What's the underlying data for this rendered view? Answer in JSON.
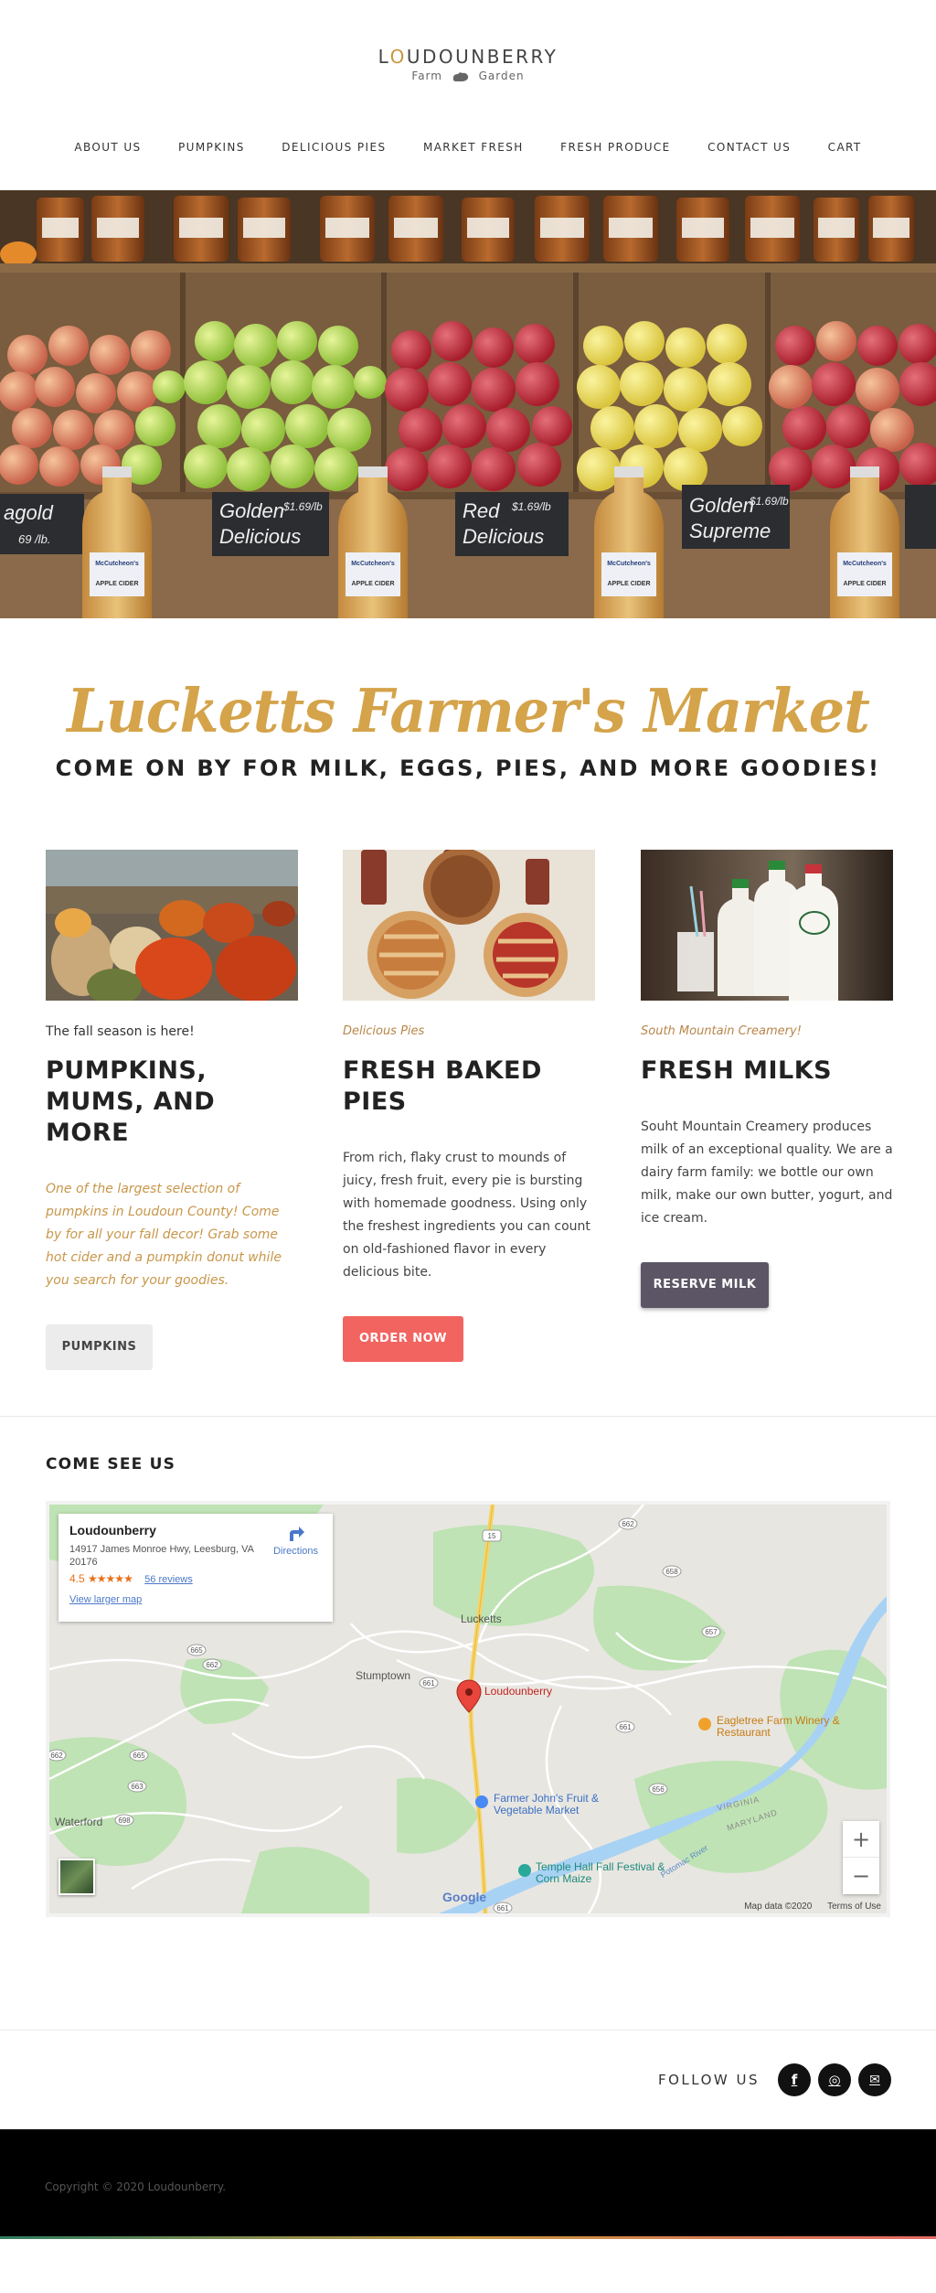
{
  "brand": {
    "name_pre": "L",
    "name_accent": "O",
    "name_post": "UDOUNBERRY",
    "sub_left": "Farm",
    "sub_right": "Garden"
  },
  "nav": {
    "items": [
      "ABOUT US",
      "PUMPKINS",
      "DELICIOUS PIES",
      "MARKET FRESH",
      "FRESH PRODUCE",
      "CONTACT US",
      "CART"
    ]
  },
  "hero": {
    "signs": [
      "agold",
      "Golden",
      "Delicious",
      "Red",
      "Delicious",
      "Golden",
      "Supreme",
      "McCutcheon's",
      "APPLE CIDER"
    ],
    "sign_prices": [
      "69 /lb.",
      "$1.69/lb",
      "$1.69/lb",
      "$1.69/lb"
    ]
  },
  "intro": {
    "script_title": "Lucketts Farmer's Market",
    "subtitle": "COME ON BY FOR MILK, EGGS, PIES, AND MORE GOODIES!"
  },
  "cards": [
    {
      "eyebrow": "The fall season is here!",
      "title": "PUMPKINS, MUMS, AND MORE",
      "text": "One of the largest selection of pumpkins in Loudoun County!  Come by for all your fall decor! Grab some hot cider and a pumpkin donut while you search for your goodies.",
      "button": "PUMPKINS"
    },
    {
      "eyebrow": "Delicious Pies",
      "title": "FRESH BAKED PIES",
      "text": "From rich, flaky crust to mounds of juicy, fresh fruit, every pie is bursting with homemade goodness. Using only the freshest ingredients you can count on old-fashioned flavor in every delicious bite.",
      "button": "ORDER NOW"
    },
    {
      "eyebrow": "South Mountain Creamery!",
      "title": "FRESH MILKS",
      "text": "Souht Mountain Creamery produces milk of an exceptional quality. We are a dairy farm family: we bottle our own milk, make our own butter, yogurt, and ice cream.",
      "button": "RESERVE MILK"
    }
  ],
  "map": {
    "heading": "COME SEE US",
    "place_name": "Loudounberry",
    "address": "14917 James Monroe Hwy, Leesburg, VA 20176",
    "rating": "4.5",
    "stars": "★★★★★",
    "reviews": "56 reviews",
    "larger_map": "View larger map",
    "directions": "Directions",
    "labels": {
      "lucketts": "Lucketts",
      "stumptown": "Stumptown",
      "waterford": "Waterford",
      "pin": "Loudounberry",
      "eagletree": "Eagletree Farm Winery & Restaurant",
      "farmer_john": "Farmer John's Fruit & Vegetable Market",
      "temple_hall": "Temple Hall Fall Festival & Corn Maize",
      "virginia": "VIRGINIA",
      "maryland": "MARYLAND",
      "potomac": "Potomac River"
    },
    "road_numbers": [
      "15",
      "662",
      "658",
      "657",
      "665",
      "662",
      "661",
      "661",
      "665",
      "662",
      "663",
      "698",
      "656",
      "661"
    ],
    "zoom_in": "+",
    "zoom_out": "−",
    "google": "Google",
    "map_data": "Map data ©2020",
    "terms": "Terms of Use"
  },
  "follow": {
    "label": "FOLLOW US",
    "icons": [
      "facebook-icon",
      "instagram-icon",
      "email-icon"
    ],
    "glyphs": [
      "f",
      "◎",
      "✉"
    ]
  },
  "footer": {
    "copyright": "Copyright © 2020 Loudounberry."
  },
  "colors": {
    "gold": "#d4a34a",
    "red_button": "#f26460",
    "dark_button": "#5b5566",
    "pin": "#d93025"
  }
}
